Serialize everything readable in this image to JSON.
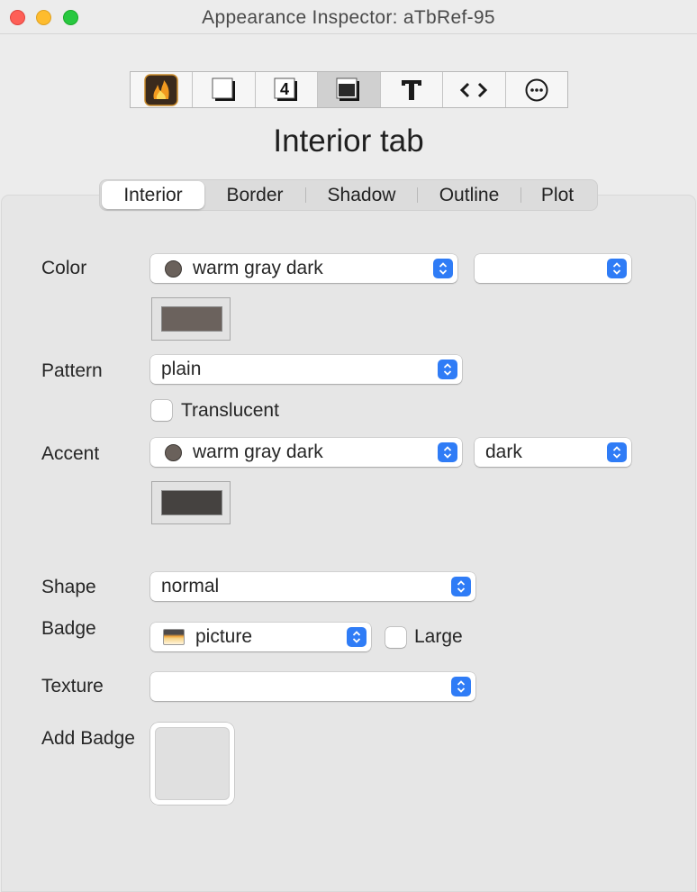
{
  "window": {
    "title": "Appearance Inspector: aTbRef-95"
  },
  "toolbar": {
    "items": [
      {
        "icon": "flame-app-icon",
        "active": false
      },
      {
        "icon": "note-shape-icon",
        "active": false
      },
      {
        "icon": "number-badge-icon",
        "text": "4",
        "active": false
      },
      {
        "icon": "interior-shading-icon",
        "active": true
      },
      {
        "icon": "text-icon",
        "text": "T",
        "active": false
      },
      {
        "icon": "code-icon",
        "text": "<>",
        "active": false
      },
      {
        "icon": "more-icon",
        "active": false
      }
    ]
  },
  "heading": "Interior tab",
  "tabs": [
    {
      "label": "Interior",
      "active": true
    },
    {
      "label": "Border",
      "active": false
    },
    {
      "label": "Shadow",
      "active": false
    },
    {
      "label": "Outline",
      "active": false
    },
    {
      "label": "Plot",
      "active": false
    }
  ],
  "form": {
    "color": {
      "label": "Color",
      "value": "warm gray dark",
      "modifier": "",
      "dot_color": "#6a615b",
      "swatch_color": "#6b625d"
    },
    "pattern": {
      "label": "Pattern",
      "value": "plain"
    },
    "translucent": {
      "label": "Translucent",
      "checked": false
    },
    "accent": {
      "label": "Accent",
      "value": "warm gray dark",
      "modifier": "dark",
      "dot_color": "#6a615b",
      "swatch_color": "#454240"
    },
    "shape": {
      "label": "Shape",
      "value": "normal"
    },
    "badge": {
      "label": "Badge",
      "value": "picture",
      "large_label": "Large",
      "large_checked": false
    },
    "texture": {
      "label": "Texture",
      "value": ""
    },
    "add_badge": {
      "label": "Add Badge"
    }
  },
  "colors": {
    "accent_blue": "#2f7cf6"
  }
}
